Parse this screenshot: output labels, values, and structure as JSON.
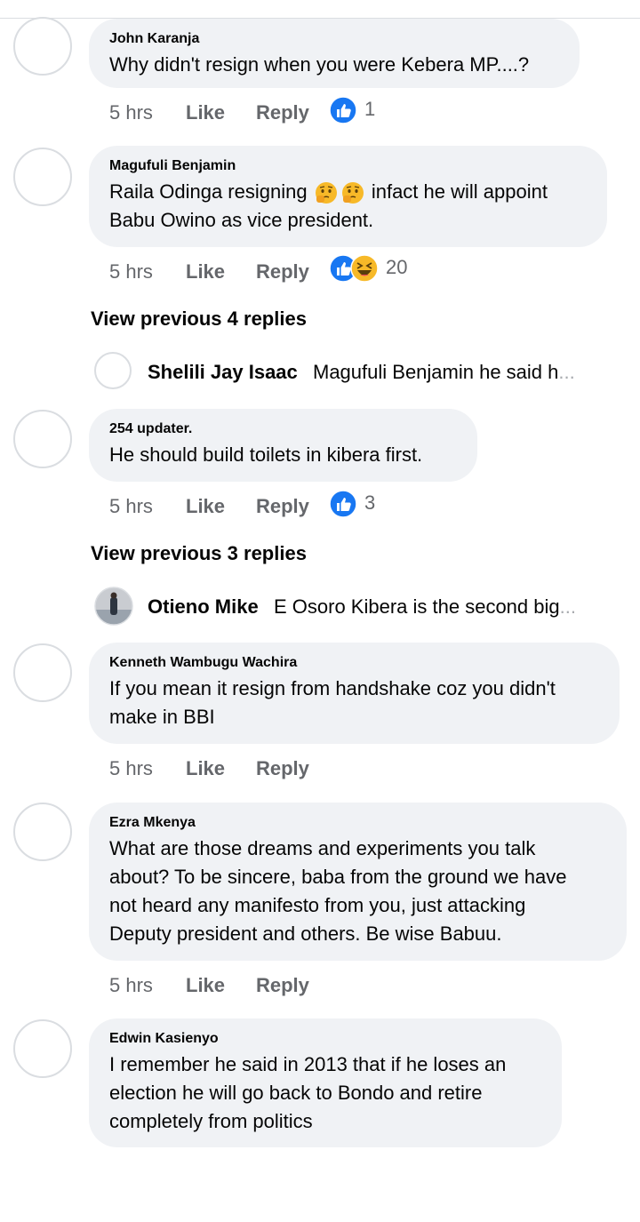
{
  "comments": [
    {
      "author": "John Karanja",
      "text": "Why didn't resign when you were Kebera MP....?",
      "time": "5 hrs",
      "like": "Like",
      "reply": "Reply",
      "reaction_count": "1"
    },
    {
      "author": "Magufuli Benjamin",
      "text_part1": "Raila Odinga resigning",
      "text_part2": "infact he will appoint",
      "text_line2": "Babu Owino as vice president.",
      "time": "5 hrs",
      "like": "Like",
      "reply": "Reply",
      "reaction_count": "20"
    },
    {
      "author": "254 updater.",
      "text": "He should build toilets in kibera first.",
      "time": "5 hrs",
      "like": "Like",
      "reply": "Reply",
      "reaction_count": "3"
    },
    {
      "author": "Kenneth Wambugu Wachira",
      "text_line1": "If you mean it resign from handshake coz you didn't",
      "text_line2": "make in BBI",
      "time": "5 hrs",
      "like": "Like",
      "reply": "Reply"
    },
    {
      "author": "Ezra Mkenya",
      "text_line1": "What are those dreams and experiments you talk",
      "text_line2": "about? To be sincere, baba from the ground we have",
      "text_line3": "not heard any manifesto from you, just attacking",
      "text_line4": "Deputy president and others. Be wise Babuu.",
      "time": "5 hrs",
      "like": "Like",
      "reply": "Reply"
    },
    {
      "author": "Edwin Kasienyo",
      "text_line1": "I remember he said in 2013 that if he loses an",
      "text_line2": "election he will go back to Bondo and retire",
      "text_line3": "completely from politics"
    }
  ],
  "view_previous_1": "View previous 4 replies",
  "view_previous_2": "View previous 3 replies",
  "nested_1": {
    "name": "Shelili Jay Isaac",
    "snippet": "Magufuli Benjamin he said h",
    "ellipsis": "..."
  },
  "nested_2": {
    "name": "Otieno Mike",
    "snippet": "E Osoro Kibera is the second big",
    "ellipsis": "..."
  },
  "colors": {
    "bubble": "#f0f2f5",
    "meta": "#65676b",
    "like_blue": "#1877f2",
    "haha_yellow": "#f7b928"
  },
  "icons": [
    "like-reaction-icon",
    "haha-reaction-icon",
    "thinking-face-emoji"
  ]
}
